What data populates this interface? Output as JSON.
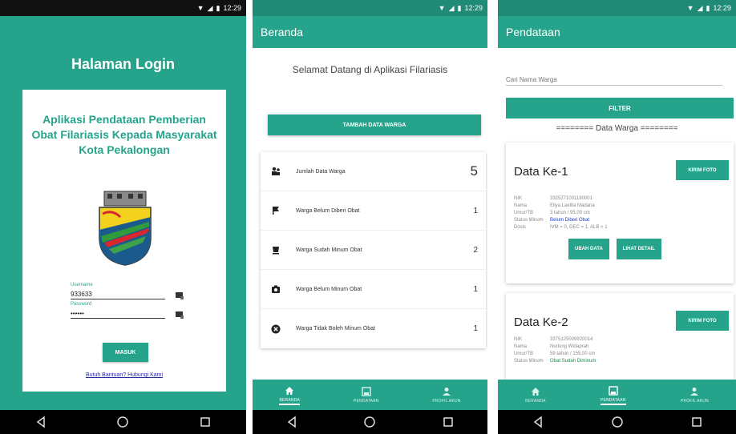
{
  "status": {
    "time": "12:29"
  },
  "login": {
    "title": "Halaman Login",
    "app_name": "Aplikasi Pendataan Pemberian Obat Filariasis Kepada Masyarakat Kota Pekalongan",
    "username_label": "Username",
    "username_value": "933633",
    "password_label": "Password",
    "password_value": "••••••",
    "submit_label": "MASUK",
    "help_link": "Butuh Bantuan? Hubungi Kami"
  },
  "home": {
    "appbar_title": "Beranda",
    "welcome": "Selamat Datang di Aplikasi Filariasis",
    "add_button": "TAMBAH DATA WARGA",
    "stats": [
      {
        "icon": "group-icon",
        "label": "Jumlah Data Warga",
        "value": "5"
      },
      {
        "icon": "flag-icon",
        "label": "Warga Belum Diberi Obat",
        "value": "1"
      },
      {
        "icon": "cup-icon",
        "label": "Warga Sudah Minum Obat",
        "value": "2"
      },
      {
        "icon": "camera-icon",
        "label": "Warga Belum Minum Obat",
        "value": "1"
      },
      {
        "icon": "close-circle-icon",
        "label": "Warga Tidak Boleh Minum Obat",
        "value": "1"
      }
    ]
  },
  "pendataan": {
    "appbar_title": "Pendataan",
    "search_placeholder": "Cari Nama Warga",
    "filter_button": "FILTER",
    "section_title": "======== Data Warga ========",
    "cards": [
      {
        "title": "Data Ke-1",
        "foto_button": "KIRIM FOTO",
        "fields": [
          {
            "key": "NIK",
            "value": "3325271001190001"
          },
          {
            "key": "Nama",
            "value": "Ellya Laelita Madana"
          },
          {
            "key": "Umur/TB",
            "value": "3 tahun / 95.00 cm"
          },
          {
            "key": "Status Minum",
            "value": "Belum Diberi Obat"
          },
          {
            "key": "Dosis",
            "value": "IVM = 0, DEC = 1, ALB = 1"
          }
        ],
        "edit_button": "UBAH DATA",
        "detail_button": "LIHAT DETAIL"
      },
      {
        "title": "Data Ke-2",
        "foto_button": "KIRIM FOTO",
        "fields": [
          {
            "key": "NIK",
            "value": "3375125009920014"
          },
          {
            "key": "Nama",
            "value": "Nurlung Widaprah"
          },
          {
            "key": "Umur/TB",
            "value": "59 tahun / 155.00 cm"
          },
          {
            "key": "Status Minum",
            "value": "Obat Sudah Diminum"
          }
        ]
      }
    ]
  },
  "bottom_nav": [
    "BERANDA",
    "PENDATAAN",
    "PROFIL AKUN"
  ],
  "colors": {
    "primary": "#25a38b",
    "primary_dark": "#1f8a76",
    "link": "#2a2a9a",
    "status_blue": "#1a3cd6",
    "status_green": "#1f8a4c"
  }
}
